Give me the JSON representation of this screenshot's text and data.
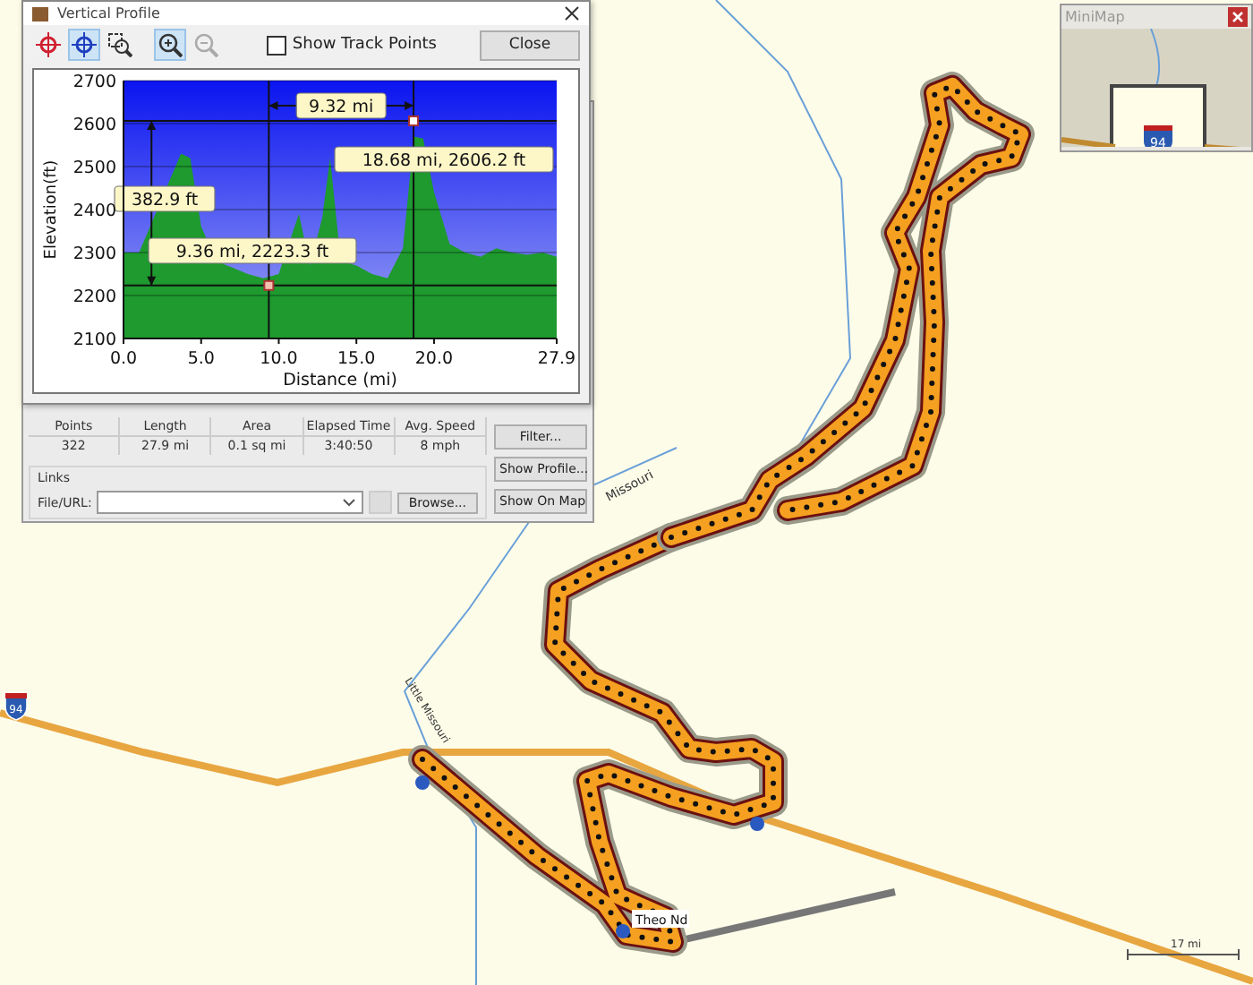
{
  "profile_window": {
    "title": "Vertical Profile",
    "tools": [
      {
        "kind": "marker",
        "selected": false,
        "disabled": false
      },
      {
        "kind": "cursor",
        "selected": true,
        "disabled": false
      },
      {
        "kind": "zoombox",
        "selected": false,
        "disabled": false
      },
      {
        "kind": "zoomin",
        "selected": true,
        "disabled": false
      },
      {
        "kind": "zoomout",
        "selected": false,
        "disabled": true
      }
    ],
    "show_track_points": {
      "label": "Show Track Points",
      "checked": false
    },
    "close_button": "Close",
    "chart_data": {
      "type": "area",
      "xlabel": "Distance   (mi)",
      "ylabel": "Elevation(ft)",
      "grid": true,
      "x": [
        0,
        1,
        3.7,
        4.3,
        5,
        6,
        7,
        8,
        9,
        10,
        11.3,
        12,
        12.8,
        13.3,
        14,
        15,
        16,
        17,
        18,
        18.7,
        19.3,
        20,
        21,
        22,
        23,
        24,
        25,
        26,
        27,
        27.9
      ],
      "series": [
        {
          "color": "#1e9a2e",
          "values": [
            2300,
            2300,
            2530,
            2520,
            2360,
            2280,
            2265,
            2250,
            2240,
            2250,
            2390,
            2270,
            2380,
            2520,
            2280,
            2270,
            2250,
            2240,
            2310,
            2570,
            2565,
            2440,
            2320,
            2300,
            2290,
            2310,
            2300,
            2295,
            2300,
            2290
          ]
        }
      ],
      "xlim": [
        0,
        27.9
      ],
      "ylim": [
        2100,
        2700
      ],
      "xticks": [
        {
          "value": 0,
          "label": "0.0"
        },
        {
          "value": 5,
          "label": "5.0"
        },
        {
          "value": 10,
          "label": "10.0"
        },
        {
          "value": 15,
          "label": "15.0"
        },
        {
          "value": 20,
          "label": "20.0"
        },
        {
          "value": 27.9,
          "label": "27.9"
        }
      ],
      "yticks": [
        2100,
        2200,
        2300,
        2400,
        2500,
        2600,
        2700
      ],
      "annotations": [
        "9.32 mi",
        "18.68 mi, 2606.2 ft",
        "382.9 ft",
        "9.36 mi, 2223.3 ft"
      ]
    }
  },
  "properties": {
    "stats": [
      {
        "label": "Points",
        "value": "322"
      },
      {
        "label": "Length",
        "value": "27.9 mi"
      },
      {
        "label": "Area",
        "value": "0.1 sq mi"
      },
      {
        "label": "Elapsed Time",
        "value": "3:40:50"
      },
      {
        "label": "Avg. Speed",
        "value": "8 mph"
      }
    ],
    "links_label": "Links",
    "file_label": "File/URL:",
    "browse_button": "Browse...",
    "side_buttons": [
      "Filter...",
      "Show Profile...",
      "Show On Map"
    ]
  },
  "minimap": {
    "title": "MiniMap",
    "shield": "94"
  },
  "map": {
    "shield": "94",
    "labels": [
      {
        "kind": "river",
        "text": "Missouri"
      },
      {
        "kind": "river",
        "text": "Little Missouri"
      },
      {
        "kind": "place",
        "text": "Theo Nd"
      }
    ],
    "scale": "17 mi"
  }
}
